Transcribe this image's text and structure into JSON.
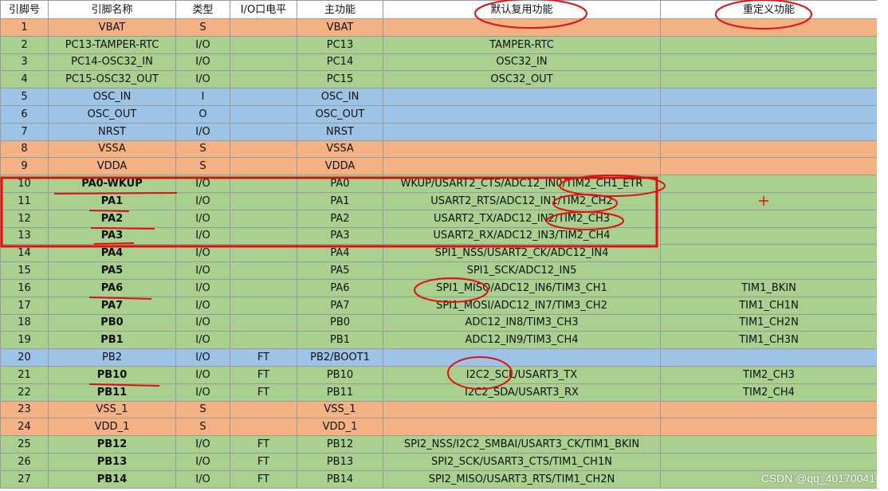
{
  "table": {
    "headers": [
      "引脚号",
      "引脚名称",
      "类型",
      "I/O口电平",
      "主功能",
      "默认复用功能",
      "重定义功能"
    ],
    "rows": [
      {
        "color": "orange",
        "pin": "1",
        "name": "VBAT",
        "bold": false,
        "type": "S",
        "level": "",
        "main": "VBAT",
        "alt": "",
        "remap": ""
      },
      {
        "color": "green",
        "pin": "2",
        "name": "PC13-TAMPER-RTC",
        "bold": false,
        "type": "I/O",
        "level": "",
        "main": "PC13",
        "alt": "TAMPER-RTC",
        "remap": ""
      },
      {
        "color": "green",
        "pin": "3",
        "name": "PC14-OSC32_IN",
        "bold": false,
        "type": "I/O",
        "level": "",
        "main": "PC14",
        "alt": "OSC32_IN",
        "remap": ""
      },
      {
        "color": "green",
        "pin": "4",
        "name": "PC15-OSC32_OUT",
        "bold": false,
        "type": "I/O",
        "level": "",
        "main": "PC15",
        "alt": "OSC32_OUT",
        "remap": ""
      },
      {
        "color": "blue",
        "pin": "5",
        "name": "OSC_IN",
        "bold": false,
        "type": "I",
        "level": "",
        "main": "OSC_IN",
        "alt": "",
        "remap": ""
      },
      {
        "color": "blue",
        "pin": "6",
        "name": "OSC_OUT",
        "bold": false,
        "type": "O",
        "level": "",
        "main": "OSC_OUT",
        "alt": "",
        "remap": ""
      },
      {
        "color": "blue",
        "pin": "7",
        "name": "NRST",
        "bold": false,
        "type": "I/O",
        "level": "",
        "main": "NRST",
        "alt": "",
        "remap": ""
      },
      {
        "color": "orange",
        "pin": "8",
        "name": "VSSA",
        "bold": false,
        "type": "S",
        "level": "",
        "main": "VSSA",
        "alt": "",
        "remap": ""
      },
      {
        "color": "orange",
        "pin": "9",
        "name": "VDDA",
        "bold": false,
        "type": "S",
        "level": "",
        "main": "VDDA",
        "alt": "",
        "remap": ""
      },
      {
        "color": "green",
        "pin": "10",
        "name": "PA0-WKUP",
        "bold": true,
        "type": "I/O",
        "level": "",
        "main": "PA0",
        "alt": "WKUP/USART2_CTS/ADC12_IN0/TIM2_CH1_ETR",
        "remap": ""
      },
      {
        "color": "green",
        "pin": "11",
        "name": "PA1",
        "bold": true,
        "type": "I/O",
        "level": "",
        "main": "PA1",
        "alt": "USART2_RTS/ADC12_IN1/TIM2_CH2",
        "remap": ""
      },
      {
        "color": "green",
        "pin": "12",
        "name": "PA2",
        "bold": true,
        "type": "I/O",
        "level": "",
        "main": "PA2",
        "alt": "USART2_TX/ADC12_IN2/TIM2_CH3",
        "remap": ""
      },
      {
        "color": "green",
        "pin": "13",
        "name": "PA3",
        "bold": true,
        "type": "I/O",
        "level": "",
        "main": "PA3",
        "alt": "USART2_RX/ADC12_IN3/TIM2_CH4",
        "remap": ""
      },
      {
        "color": "green",
        "pin": "14",
        "name": "PA4",
        "bold": true,
        "type": "I/O",
        "level": "",
        "main": "PA4",
        "alt": "SPI1_NSS/USART2_CK/ADC12_IN4",
        "remap": ""
      },
      {
        "color": "green",
        "pin": "15",
        "name": "PA5",
        "bold": true,
        "type": "I/O",
        "level": "",
        "main": "PA5",
        "alt": "SPI1_SCK/ADC12_IN5",
        "remap": ""
      },
      {
        "color": "green",
        "pin": "16",
        "name": "PA6",
        "bold": true,
        "type": "I/O",
        "level": "",
        "main": "PA6",
        "alt": "SPI1_MISO/ADC12_IN6/TIM3_CH1",
        "remap": "TIM1_BKIN"
      },
      {
        "color": "green",
        "pin": "17",
        "name": "PA7",
        "bold": true,
        "type": "I/O",
        "level": "",
        "main": "PA7",
        "alt": "SPI1_MOSI/ADC12_IN7/TIM3_CH2",
        "remap": "TIM1_CH1N"
      },
      {
        "color": "green",
        "pin": "18",
        "name": "PB0",
        "bold": true,
        "type": "I/O",
        "level": "",
        "main": "PB0",
        "alt": "ADC12_IN8/TIM3_CH3",
        "remap": "TIM1_CH2N"
      },
      {
        "color": "green",
        "pin": "19",
        "name": "PB1",
        "bold": true,
        "type": "I/O",
        "level": "",
        "main": "PB1",
        "alt": "ADC12_IN9/TIM3_CH4",
        "remap": "TIM1_CH3N"
      },
      {
        "color": "blue",
        "pin": "20",
        "name": "PB2",
        "bold": false,
        "type": "I/O",
        "level": "FT",
        "main": "PB2/BOOT1",
        "alt": "",
        "remap": ""
      },
      {
        "color": "green",
        "pin": "21",
        "name": "PB10",
        "bold": true,
        "type": "I/O",
        "level": "FT",
        "main": "PB10",
        "alt": "I2C2_SCL/USART3_TX",
        "remap": "TIM2_CH3"
      },
      {
        "color": "green",
        "pin": "22",
        "name": "PB11",
        "bold": true,
        "type": "I/O",
        "level": "FT",
        "main": "PB11",
        "alt": "I2C2_SDA/USART3_RX",
        "remap": "TIM2_CH4"
      },
      {
        "color": "orange",
        "pin": "23",
        "name": "VSS_1",
        "bold": false,
        "type": "S",
        "level": "",
        "main": "VSS_1",
        "alt": "",
        "remap": ""
      },
      {
        "color": "orange",
        "pin": "24",
        "name": "VDD_1",
        "bold": false,
        "type": "S",
        "level": "",
        "main": "VDD_1",
        "alt": "",
        "remap": ""
      },
      {
        "color": "green",
        "pin": "25",
        "name": "PB12",
        "bold": true,
        "type": "I/O",
        "level": "FT",
        "main": "PB12",
        "alt": "SPI2_NSS/I2C2_SMBAI/USART3_CK/TIM1_BKIN",
        "remap": ""
      },
      {
        "color": "green",
        "pin": "26",
        "name": "PB13",
        "bold": true,
        "type": "I/O",
        "level": "FT",
        "main": "PB13",
        "alt": "SPI2_SCK/USART3_CTS/TIM1_CH1N",
        "remap": ""
      },
      {
        "color": "green",
        "pin": "27",
        "name": "PB14",
        "bold": true,
        "type": "I/O",
        "level": "FT",
        "main": "PB14",
        "alt": "SPI2_MISO/USART3_RTS/TIM1_CH2N",
        "remap": ""
      }
    ]
  },
  "colors": {
    "orange": "#f4b183",
    "green": "#a9d08e",
    "blue": "#9dc3e6",
    "annotation": "#e01010"
  },
  "watermark": "CSDN @qq_40170041"
}
